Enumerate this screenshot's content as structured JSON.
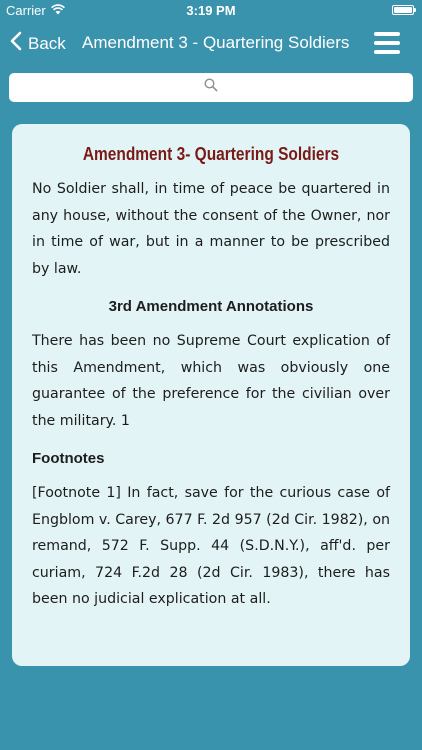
{
  "status_bar": {
    "carrier": "Carrier",
    "time": "3:19 PM"
  },
  "nav": {
    "back_label": "Back",
    "title": "Amendment 3 - Quartering Soldiers"
  },
  "search": {
    "placeholder": "",
    "value": ""
  },
  "content": {
    "title": "Amendment 3- Quartering Soldiers",
    "text": "No Soldier shall, in time of peace be quartered in any house, without the consent of the Owner, nor in time of war, but in a manner to be prescribed by law.",
    "annotations_heading": "3rd Amendment Annotations",
    "annotation_text": "There has been no Supreme Court explication of this Amendment, which was obviously one guarantee of the preference for the civilian over the military. 1",
    "footnotes_heading": "Footnotes",
    "footnote_text": "[Footnote 1] In fact, save for the curious case of Engblom v. Carey, 677 F. 2d 957 (2d Cir. 1982), on remand, 572 F. Supp. 44 (S.D.N.Y.), aff'd. per curiam, 724 F.2d 28 (2d Cir. 1983), there has been no judicial explication at all."
  },
  "colors": {
    "background": "#3a93ad",
    "card": "#e3f4f6",
    "title": "#7a1a16"
  }
}
